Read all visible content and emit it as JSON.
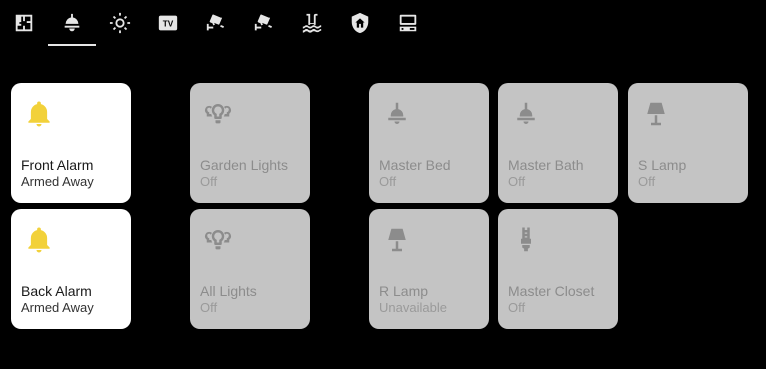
{
  "tabs": [
    {
      "icon": "floorplan-icon",
      "active": false
    },
    {
      "icon": "ceiling-light-icon",
      "active": true
    },
    {
      "icon": "brightness-icon",
      "active": false
    },
    {
      "icon": "tv-icon",
      "active": false
    },
    {
      "icon": "cctv-camera-icon",
      "active": false
    },
    {
      "icon": "cctv-camera-icon",
      "active": false
    },
    {
      "icon": "pool-icon",
      "active": false
    },
    {
      "icon": "shield-home-icon",
      "active": false
    },
    {
      "icon": "desktop-computer-icon",
      "active": false
    }
  ],
  "cards": [
    {
      "name": "Front Alarm",
      "state": "Armed Away",
      "icon": "bell-icon",
      "on": true
    },
    {
      "name": "Back Alarm",
      "state": "Armed Away",
      "icon": "bell-icon",
      "on": true
    },
    {
      "name": "Garden Lights",
      "state": "Off",
      "icon": "lightbulb-group-icon",
      "on": false
    },
    {
      "name": "All Lights",
      "state": "Off",
      "icon": "lightbulb-group-icon",
      "on": false
    },
    {
      "name": "Master Bed",
      "state": "Off",
      "icon": "ceiling-lamp-icon",
      "on": false
    },
    {
      "name": "Master Bath",
      "state": "Off",
      "icon": "ceiling-lamp-icon",
      "on": false
    },
    {
      "name": "S Lamp",
      "state": "Off",
      "icon": "table-lamp-icon",
      "on": false
    },
    {
      "name": "R Lamp",
      "state": "Unavailable",
      "icon": "table-lamp-icon",
      "on": false
    },
    {
      "name": "Master Closet",
      "state": "Off",
      "icon": "cfl-bulb-icon",
      "on": false
    }
  ],
  "colors": {
    "background": "#000000",
    "card_on": "#ffffff",
    "card_off": "#c4c4c4",
    "alarm_icon": "#f2d13a",
    "off_icon": "#8c8c8c",
    "tab_icon": "#e6e6e6"
  }
}
